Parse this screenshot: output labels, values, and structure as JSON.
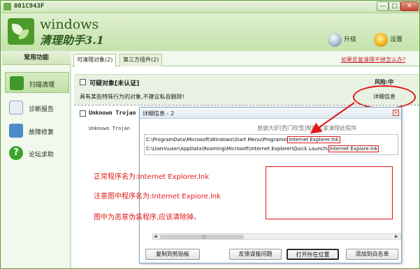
{
  "window": {
    "title": "001C943F",
    "min_glyph": "—",
    "max_glyph": "□",
    "close_glyph": "✕"
  },
  "header": {
    "app_name": "windows",
    "app_subtitle": "清理助手3.1",
    "upgrade_label": "升级",
    "settings_label": "设置"
  },
  "sidebar": {
    "heading": "常用功能",
    "items": [
      {
        "label": "扫描清理"
      },
      {
        "label": "诊断报告"
      },
      {
        "label": "故障修复"
      },
      {
        "label": "论坛求助"
      }
    ],
    "help_glyph": "?"
  },
  "tabs": [
    {
      "label": "可清理对象(2)"
    },
    {
      "label": "第三方插件(2)"
    }
  ],
  "help_link": "如果反复清理不掉怎么办?",
  "item1": {
    "name": "可疑对象[未认证]",
    "risk": "风险:中",
    "desc": "具有某些特殊行为的对象,不建议私自删除!",
    "detail_link": "详细信息"
  },
  "item2": {
    "name": "Unknown Trojan",
    "desc": "Unknown Trojan"
  },
  "dialog": {
    "title": "详细信息 - 2",
    "close_glyph": "✕",
    "note": "感谢大虾[西门吹雪]帮助大家清理此程序",
    "path1_prefix": "C:\\ProgramData\\Microsoft\\Windows\\Start Menu\\Programs\\",
    "path1_highlight": "Internet Explorer.lnk",
    "path2_prefix": "C:\\Users\\user\\AppData\\Roaming\\Microsoft\\Internet Explorer\\Quick Launch\\",
    "path2_highlight": "Internet Expiore.lnk",
    "scroll_left": "◀",
    "scroll_right": "▶",
    "scroll_grip": "|||",
    "buttons": {
      "copy": "复制到剪贴板",
      "report": "反馈误报问题",
      "open": "打开所在位置",
      "whitelist": "添加到白名单"
    }
  },
  "annotations": {
    "line1": "正常程序名为:Internet Explorer.lnk",
    "line2": "注意图中程序名为:Internet Expiore.lnk",
    "line3": "图中为恶意伪装程序,应该清除掉。"
  },
  "colors": {
    "annotation_red": "#e01818",
    "brand_green": "#4c9a2a",
    "link_red": "#c0262d"
  }
}
